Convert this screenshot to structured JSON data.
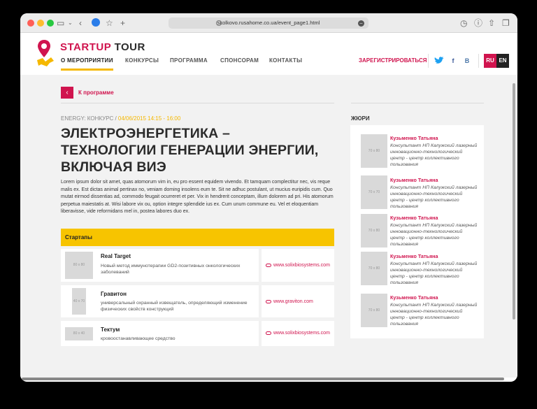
{
  "browser": {
    "url": "skolkovo.rusahome.co.ua/event_page1.html"
  },
  "header": {
    "brand_accent": "STARTUP",
    "brand_rest": "TOUR",
    "nav": [
      "О МЕРОПРИЯТИИ",
      "КОНКУРСЫ",
      "ПРОГРАММА",
      "СПОНСОРАМ",
      "КОНТАКТЫ"
    ],
    "register": "ЗАРЕГИСТРИРОВАТЬСЯ",
    "social": {
      "facebook": "f",
      "vk": "В"
    },
    "languages": [
      "RU",
      "EN"
    ]
  },
  "colors": {
    "accent": "#d0144e",
    "highlight": "#f5b800",
    "twitter": "#1da1f2",
    "facebook": "#3b5998",
    "vk": "#4a76a8"
  },
  "back": {
    "label": "К программе"
  },
  "event": {
    "category": "ENERGY: КОНКУРС /",
    "date": " 04/06/2015 14:15 - 16:00",
    "title_lines": [
      "ЭЛЕКТРОЭНЕРГЕТИКА –",
      "ТЕХНОЛОГИИ ГЕНЕРАЦИИ ЭНЕРГИИ,",
      "ВКЛЮЧАЯ ВИЭ"
    ],
    "description": "Lorem ipsum dolor sit amet, quas atomorum vim in, eu pro essent equidem vivendo. Et tamquam complectitur nec, vis reque malis ex. Est dictas animal pertinax no, veniam doming insolens eum te. Sit ne adhuc postulant, ut mucius euripidis cum. Quo mutat eirmod dissentias ad, commodo feugait ocurreret et per. Vix in hendrerit conceptam, illum dolorem ad pri. His atomorum perpetua maiestatis at. Wisi labore vix ou, option integre splendide ius ex. Cum unum commune eu. Vel et eloquentiam liberavisse, vide reformidans mel in, postea labores duo ex."
  },
  "startups": {
    "heading": "Стартапы",
    "items": [
      {
        "thumb": "80 x 80",
        "name": "Real Target",
        "desc": "Новый метод иммунотерапии GD2-позитивных онкологических заболеваний",
        "link": "www.solixbiosystems.com"
      },
      {
        "thumb": "40 x 70",
        "name": "Гравитон",
        "desc": "универсальный охранный извещатель, определяющий изменение физических свойств конструкций",
        "link": "www.graviton.com"
      },
      {
        "thumb": "80 x 40",
        "name": "Тектум",
        "desc": "кровоостанавливающее средство",
        "link": "www.solixbiosystems.com"
      }
    ]
  },
  "jury": {
    "heading": "ЖЮРИ",
    "members": [
      {
        "photo": "70 x 80",
        "name": "Кузьменко Татьяна",
        "role": "Консультант НП Калужский лазерный инновационно-технологический центр - центр коллективного пользования"
      },
      {
        "photo": "70 x 70",
        "name": "Кузьменко Татьяна",
        "role": "Консультант НП Калужский лазерный инновационно-технологический центр - центр коллективного пользования"
      },
      {
        "photo": "70 x 80",
        "name": "Кузьменко Татьяна",
        "role": "Консультант НП Калужский лазерный инновационно-технологический центр - центр коллективного пользования"
      },
      {
        "photo": "70 x 80",
        "name": "Кузьменко Татьяна",
        "role": "Консультант НП Калужский лазерный инновационно-технологический центр - центр коллективного пользования"
      },
      {
        "photo": "70 x 80",
        "name": "Кузьменко Татьяна",
        "role": "Консультант НП Калужский лазерный инновационно-технологический центр - центр коллективного пользования"
      }
    ]
  }
}
